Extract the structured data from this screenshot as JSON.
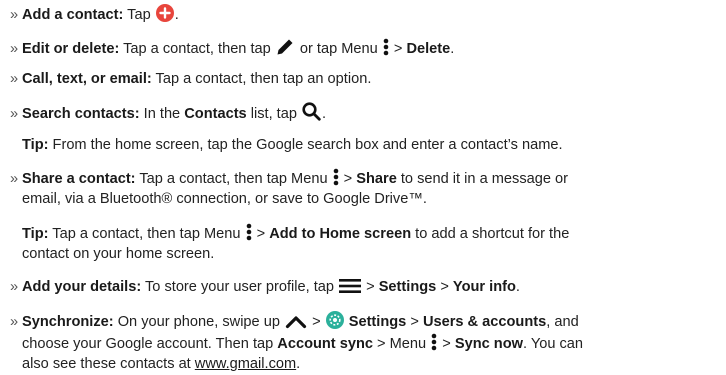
{
  "bullet": "»",
  "colors": {
    "add_button": "#e8453c",
    "settings_icon": "#2bb09b",
    "text": "#222222"
  },
  "icons": {
    "add": "plus-circle-icon",
    "edit": "pencil-icon",
    "menu": "vertical-dots-menu-icon",
    "search": "magnifier-icon",
    "hamburger": "hamburger-menu-icon",
    "swipe": "chevron-up-icon",
    "settings": "settings-gear-icon"
  },
  "items": {
    "add": {
      "label": "Add a contact:",
      "t1": " Tap ",
      "t2": "."
    },
    "edit": {
      "label": "Edit or delete:",
      "t1": " Tap a contact, then tap ",
      "t2": " or tap Menu ",
      "t3": " > ",
      "b1": "Delete",
      "t4": "."
    },
    "call": {
      "label": "Call, text, or email:",
      "t1": " Tap a contact, then tap an option."
    },
    "search": {
      "label": "Search contacts:",
      "t1": " In the ",
      "b1": "Contacts",
      "t2": " list, tap ",
      "t3": "."
    },
    "tip1": {
      "label": "Tip:",
      "t1": " From the home screen, tap the Google search box and enter a contact’s name."
    },
    "share": {
      "label": "Share a contact:",
      "t1": " Tap a contact, then tap Menu ",
      "t2": " > ",
      "b1": "Share",
      "t3": " to send it in a message or",
      "l2": "email, via a Bluetooth® connection, or save to Google Drive™."
    },
    "tip2": {
      "label": "Tip:",
      "t1": " Tap a contact, then tap Menu ",
      "t2": " > ",
      "b1": "Add to Home screen",
      "t3": " to add a shortcut for the",
      "l2": "contact on your home screen."
    },
    "details": {
      "label": "Add your details:",
      "t1": " To store your user profile, tap ",
      "t2": " > ",
      "b1": "Settings",
      "t3": " > ",
      "b2": "Your info",
      "t4": "."
    },
    "sync": {
      "label": "Synchronize:",
      "t1": " On your phone, swipe up ",
      "t2": " > ",
      "b1": "Settings",
      "t3": " > ",
      "b2": "Users & accounts",
      "t4": ", and",
      "l2a": "choose your Google account. Then tap ",
      "b3": "Account sync",
      "l2b": " > Menu ",
      "l2c": " > ",
      "b4": "Sync now",
      "l2d": ". You can",
      "l3a": "also see these contacts at ",
      "link": "www.gmail.com",
      "l3b": "."
    }
  }
}
